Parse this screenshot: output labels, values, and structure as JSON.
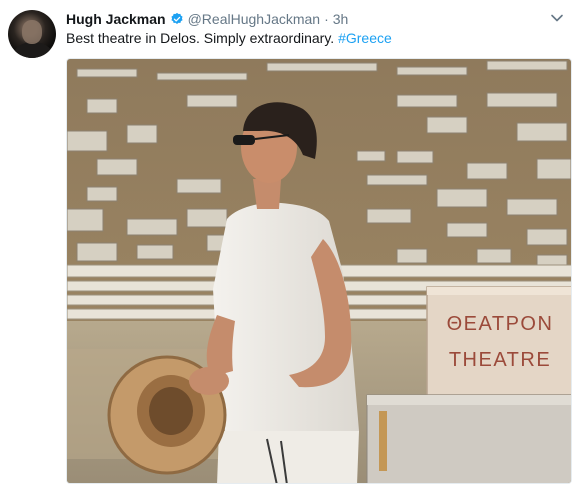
{
  "tweet": {
    "author_name": "Hugh Jackman",
    "handle": "@RealHughJackman",
    "separator": "·",
    "time": "3h",
    "text": "Best theatre in Delos. Simply extraordinary. ",
    "hashtag": "#Greece",
    "verified_icon": "verified-badge-icon",
    "more_icon": "chevron-down-icon"
  },
  "photo": {
    "sign_line_1": "ΘΕΑΤΡΟΝ",
    "sign_line_2": "THEATRE"
  },
  "colors": {
    "link": "#1da1f2",
    "secondary_text": "#657786",
    "verified": "#1da1f2"
  }
}
